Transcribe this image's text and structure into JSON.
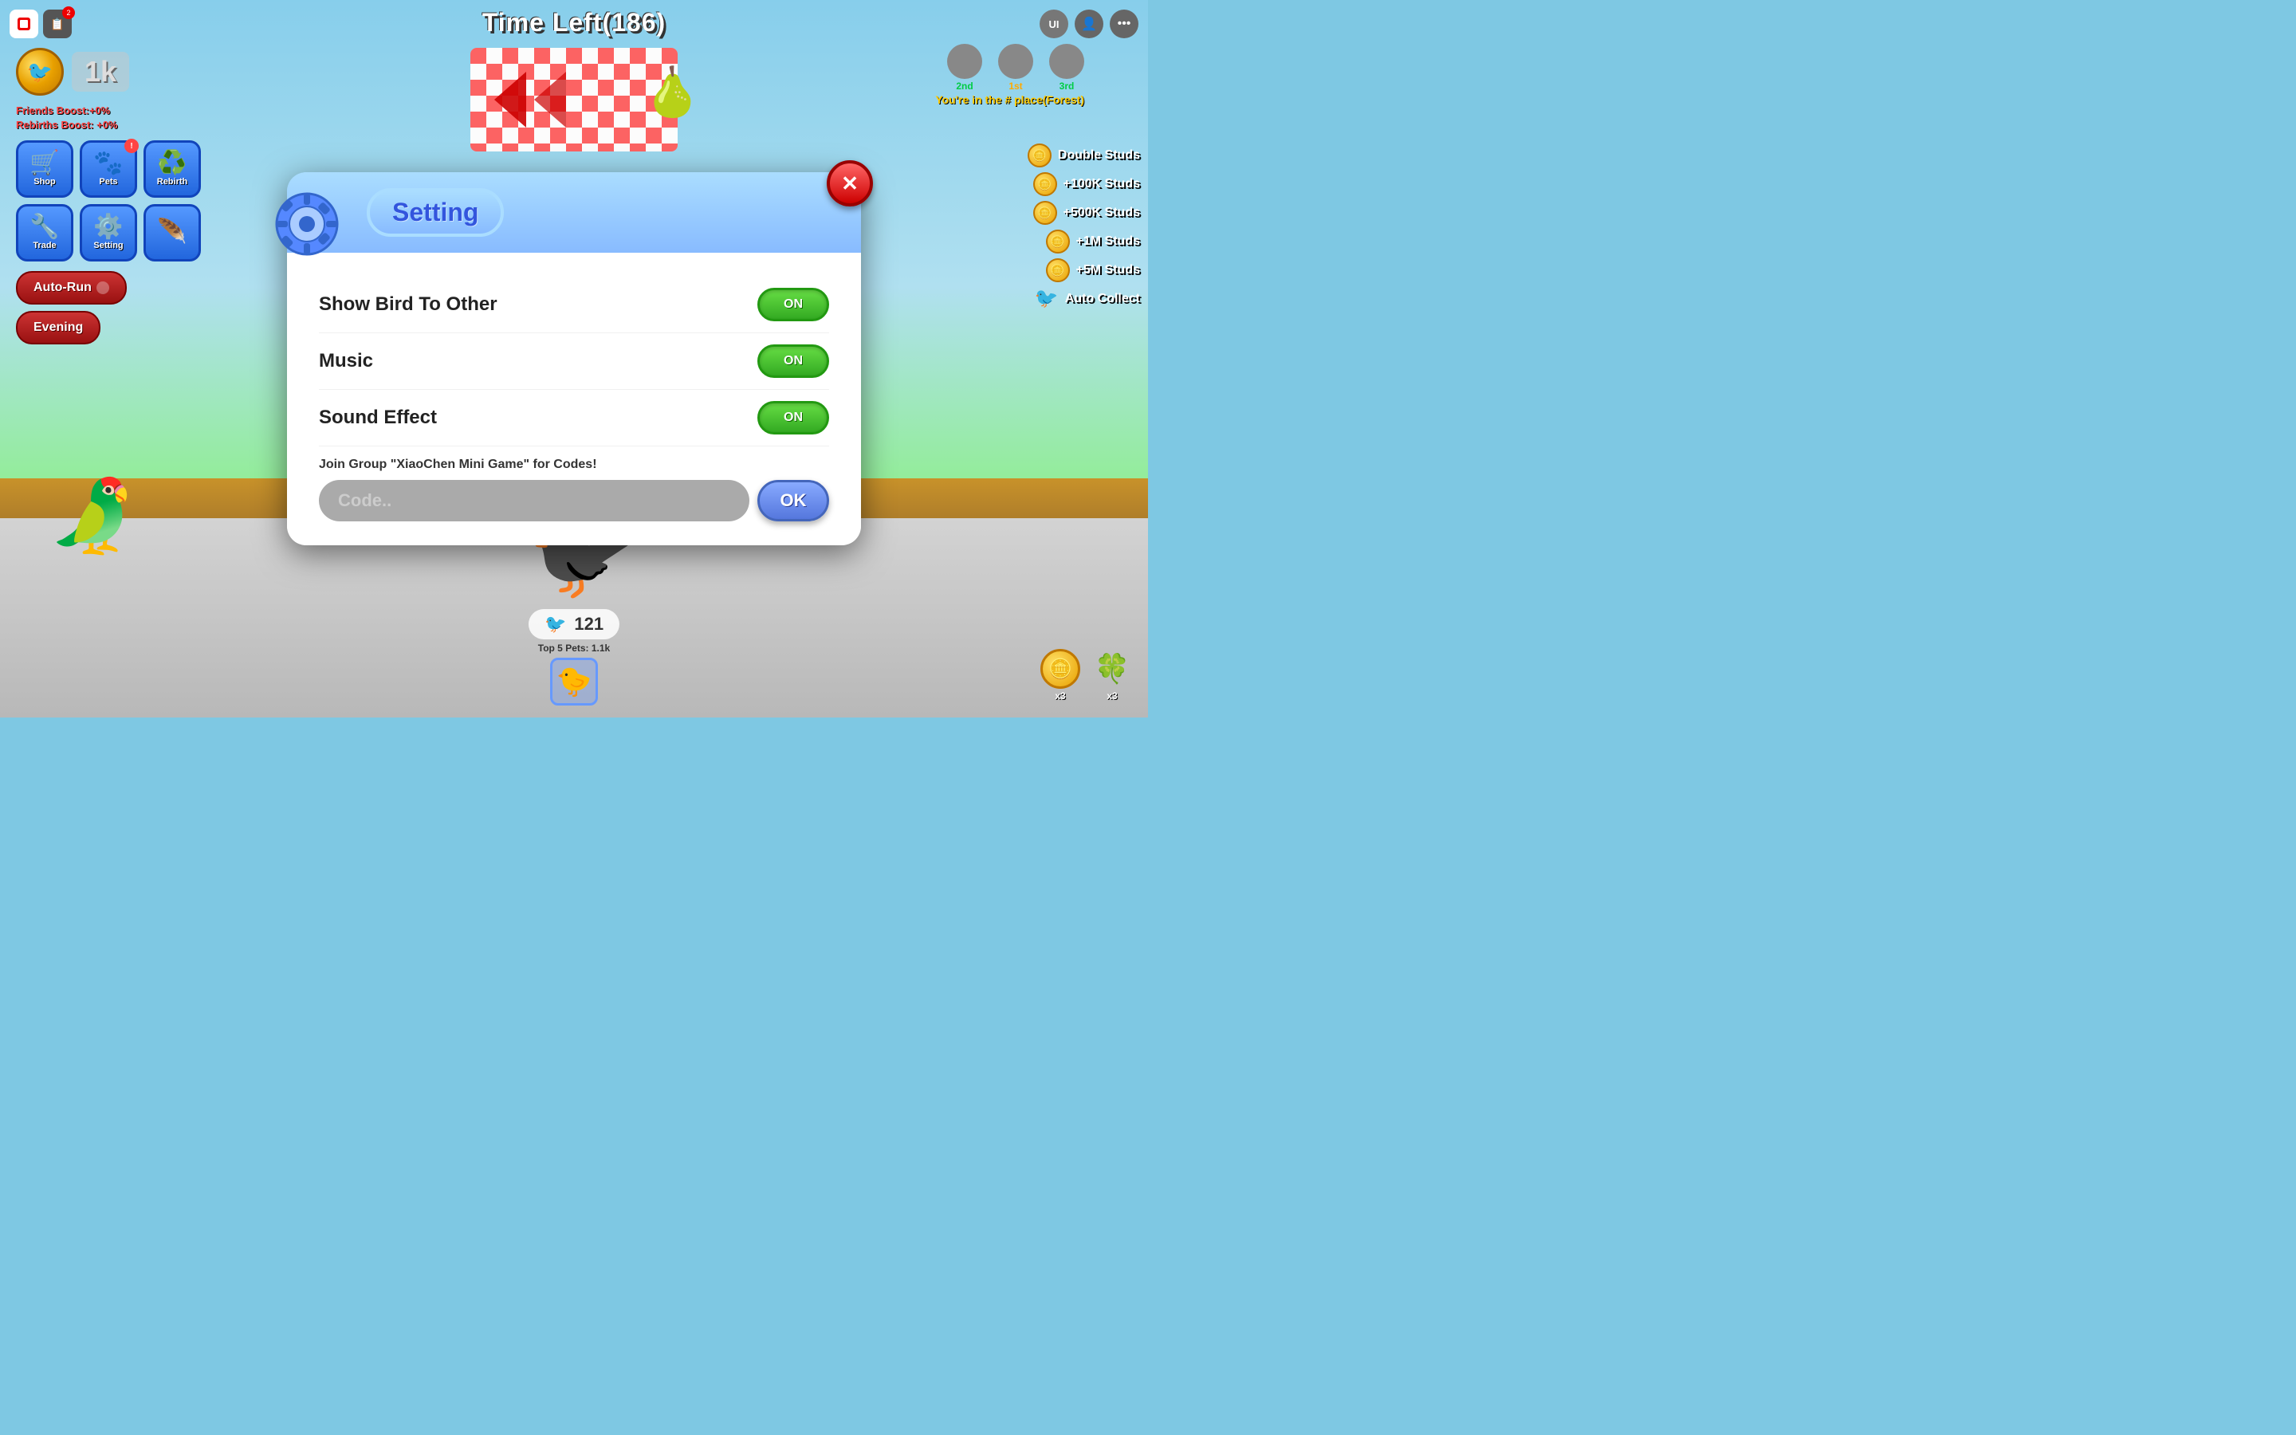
{
  "game": {
    "title": "Time Left(186)",
    "place_text": "You're in the # place(Forest)"
  },
  "top_bar": {
    "timer": "Time Left(186)",
    "roblox_icon": "■",
    "notif_count": "2"
  },
  "places": {
    "second": "2nd",
    "first": "1st",
    "third": "3rd"
  },
  "left_panel": {
    "coin_amount": "1k",
    "friends_boost": "Friends Boost:+0%",
    "rebirths_boost": "Rebirths Boost: +0%"
  },
  "menu_buttons": [
    {
      "id": "shop",
      "label": "Shop",
      "icon": "🛒",
      "badge": null
    },
    {
      "id": "pets",
      "label": "Pets",
      "icon": "🐾",
      "badge": "!"
    },
    {
      "id": "rebirth",
      "label": "Rebirth",
      "icon": "♻️",
      "badge": null
    },
    {
      "id": "trade",
      "label": "Trade",
      "icon": "🔧",
      "badge": null
    },
    {
      "id": "setting",
      "label": "Setting",
      "icon": "⚙️",
      "badge": null
    },
    {
      "id": "special",
      "label": "",
      "icon": "🪶",
      "badge": null
    }
  ],
  "action_buttons": {
    "auto_run": "Auto-Run",
    "evening": "Evening"
  },
  "store_items": [
    {
      "id": "double_studs",
      "label": "Double Studs"
    },
    {
      "id": "100k_studs",
      "label": "+100K Studs"
    },
    {
      "id": "500k_studs",
      "label": "+500K Studs"
    },
    {
      "id": "1m_studs",
      "label": "+1M Studs"
    },
    {
      "id": "5m_studs",
      "label": "+5M Studs"
    },
    {
      "id": "auto_collect",
      "label": "Auto Collect"
    }
  ],
  "bottom_bar": {
    "pet_icon": "🐦",
    "pet_count": "121",
    "pets_label": "Top 5 Pets: 1.1k"
  },
  "bottom_right": {
    "coin_x3": "x3",
    "clover_x3": "x3"
  },
  "setting_modal": {
    "title": "Setting",
    "close_label": "✕",
    "settings": [
      {
        "id": "show_bird",
        "label": "Show Bird To Other",
        "value": "ON"
      },
      {
        "id": "music",
        "label": "Music",
        "value": "ON"
      },
      {
        "id": "sound_effect",
        "label": "Sound Effect",
        "value": "ON"
      }
    ],
    "group_text": "Join Group \"XiaoChen Mini Game\" for Codes!",
    "code_placeholder": "Code..",
    "ok_label": "OK"
  }
}
